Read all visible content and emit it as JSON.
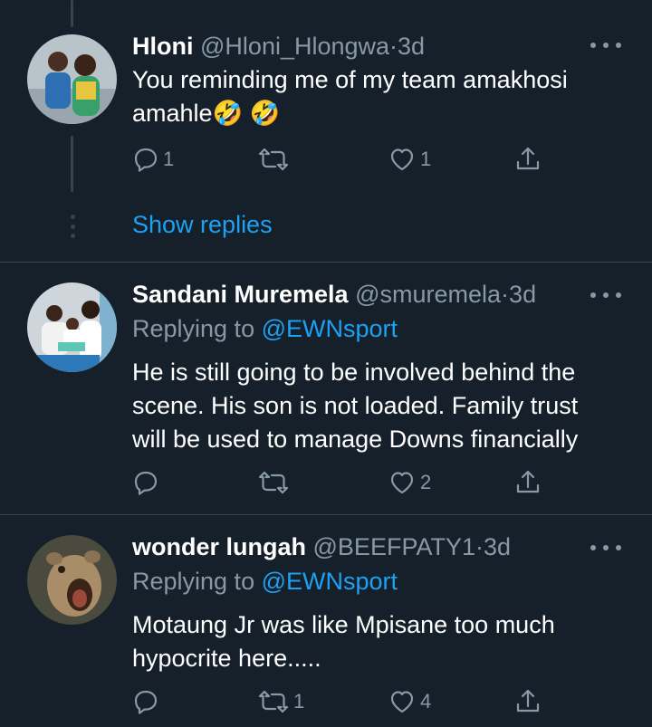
{
  "tweets": [
    {
      "name": "Hloni",
      "handle": "@Hloni_Hlongwa",
      "sep": "·",
      "time": "3d",
      "replying_prefix": "",
      "replying_mention": "",
      "lines": [
        "You reminding me of my team amakhosi",
        "amahle🤣 🤣"
      ],
      "reply_count": "1",
      "retweet_count": "",
      "like_count": "1",
      "avatar_icon": "couple-photo-avatar"
    },
    {
      "name": "Sandani Muremela",
      "handle": "@smuremela",
      "sep": "·",
      "time": "3d",
      "replying_prefix": "Replying to ",
      "replying_mention": "@EWNsport",
      "lines": [
        "He is still going to be involved behind the",
        "scene. His son is not loaded. Family trust",
        "will be used to manage Downs financially"
      ],
      "reply_count": "",
      "retweet_count": "",
      "like_count": "2",
      "avatar_icon": "family-photo-avatar"
    },
    {
      "name": "wonder lungah",
      "handle": "@BEEFPATY1",
      "sep": "·",
      "time": "3d",
      "replying_prefix": "Replying to ",
      "replying_mention": "@EWNsport",
      "lines": [
        "Motaung Jr was like Mpisane too much",
        "hypocrite here....."
      ],
      "reply_count": "",
      "retweet_count": "1",
      "like_count": "4",
      "avatar_icon": "lioness-photo-avatar"
    }
  ],
  "show_replies_label": "Show replies",
  "colors": {
    "background": "#15202b",
    "accent": "#1da1f2",
    "muted": "#8899a6",
    "divider": "#38444d"
  }
}
